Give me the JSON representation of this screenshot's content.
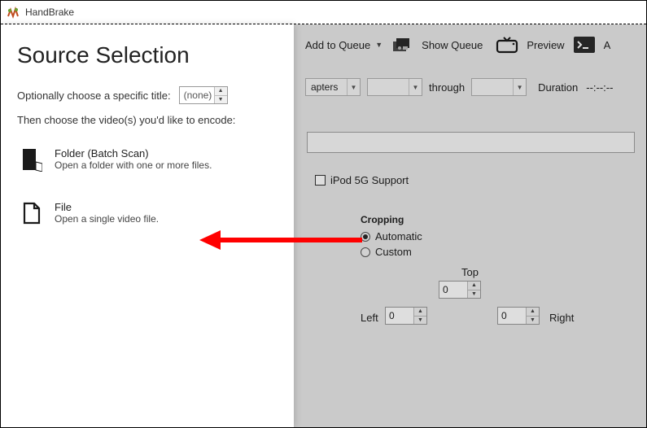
{
  "app": {
    "name": "HandBrake"
  },
  "toolbar": {
    "addQueue": "Add to Queue",
    "showQueue": "Show Queue",
    "preview": "Preview",
    "extra": "A"
  },
  "range": {
    "dropdown1": "apters",
    "through": "through",
    "durationLabel": "Duration",
    "durationValue": "--:--:--"
  },
  "ipod": {
    "label": "iPod 5G Support"
  },
  "cropping": {
    "header": "Cropping",
    "auto": "Automatic",
    "custom": "Custom",
    "top": "Top",
    "left": "Left",
    "right": "Right",
    "valTop": "0",
    "valLeft": "0",
    "valRight": "0"
  },
  "panel": {
    "title": "Source Selection",
    "optLabel": "Optionally choose a specific title:",
    "none": "(none)",
    "hint": "Then choose the video(s) you'd like to encode:",
    "folder": {
      "title": "Folder (Batch Scan)",
      "sub": "Open a folder with one or more files."
    },
    "file": {
      "title": "File",
      "sub": "Open a single video file."
    }
  }
}
